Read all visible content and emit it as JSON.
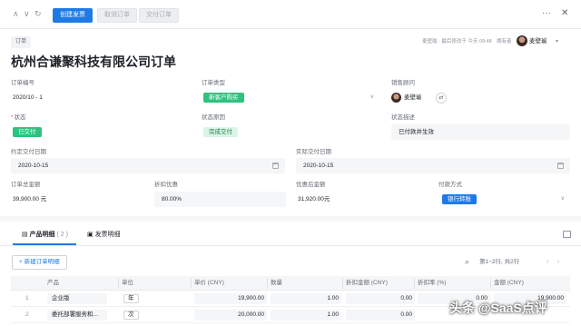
{
  "toolbar": {
    "primary_button": "创建发票",
    "cancel_button": "取消订单",
    "deliver_button": "交付订单",
    "nav_up": "∧",
    "nav_down": "∨",
    "refresh": "↻",
    "more": "···",
    "close": "✕"
  },
  "header": {
    "breadcrumb": "订单",
    "modified_meta": "麦壁瑜 · 最后修改于 今天 09:48",
    "owner_label": "拥有者",
    "owner_name": "麦壁瑜",
    "title": "杭州合谦聚科技有限公司订单"
  },
  "fields": {
    "order_no": {
      "label": "订单编号",
      "value": "2020/10 - 1"
    },
    "order_type": {
      "label": "订单类型",
      "value": "新客户购买"
    },
    "sales_rep": {
      "label": "销售顾问",
      "value": "麦壁瑜"
    },
    "status": {
      "label": "状态",
      "value": "已交付"
    },
    "status_reason": {
      "label": "状态原因",
      "value": "完成交付"
    },
    "status_desc": {
      "label": "状态描述",
      "value": "已付款并生效"
    },
    "agreed_date": {
      "label": "约定交付日期",
      "value": "2020-10-15"
    },
    "actual_date": {
      "label": "实际交付日期",
      "value": "2020-10-15"
    },
    "total": {
      "label": "订单总金额",
      "value": "39,900.00 元"
    },
    "discount": {
      "label": "折扣优惠",
      "value": "80.00%"
    },
    "after_discount": {
      "label": "优惠后金额",
      "value": "31,920.00元"
    },
    "payment": {
      "label": "付款方式",
      "value": "银行转账"
    }
  },
  "tabs": {
    "products": "产品明细",
    "products_count": "( 2 )",
    "invoices": "发票明细"
  },
  "table_toolbar": {
    "add_button": "+ 新建订单明细",
    "paging": "第1~2行, 共2行",
    "prev": "‹",
    "next": "›"
  },
  "table": {
    "headers": {
      "product": "产品",
      "unit": "单位",
      "price": "单价 (CNY)",
      "qty": "数量",
      "discount_amt": "折扣金额 (CNY)",
      "discount_rate": "折扣率 (%)",
      "amount": "金额 (CNY)"
    },
    "rows": [
      {
        "no": "1",
        "product": "企业版",
        "unit": "年",
        "price": "19,900.00",
        "qty": "1.00",
        "discount_amt": "0.00",
        "discount_rate": "0.00",
        "amount": "19,900.00"
      },
      {
        "no": "2",
        "product": "委托部署服务和...",
        "unit": "次",
        "price": "20,000.00",
        "qty": "1.00",
        "discount_amt": "0.00",
        "discount_rate": "",
        "amount": ""
      }
    ]
  },
  "watermark": "头条 @SaaS点评",
  "colors": {
    "primary": "#1e7be6",
    "success": "#2ec27e",
    "success_light": "#d8f5e6",
    "required": "#f54a45"
  }
}
